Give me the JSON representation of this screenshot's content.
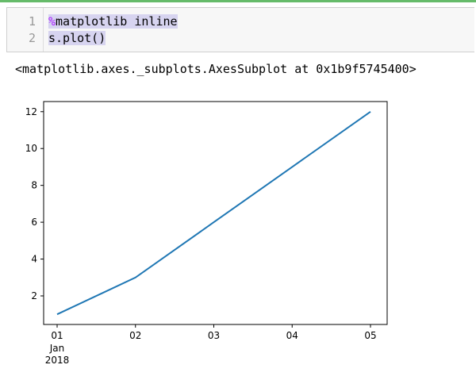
{
  "cell": {
    "line_numbers": [
      "1",
      "2"
    ],
    "line1_magic": "%",
    "line1_rest": "matplotlib inline",
    "line2": "s.plot()"
  },
  "output": {
    "repr": "<matplotlib.axes._subplots.AxesSubplot at 0x1b9f5745400>"
  },
  "chart_data": {
    "type": "line",
    "x": [
      "2018-01-01",
      "2018-01-02",
      "2018-01-03",
      "2018-01-04",
      "2018-01-05"
    ],
    "values": [
      1,
      3,
      6,
      9,
      12
    ],
    "xticks": [
      "01",
      "02",
      "03",
      "04",
      "05"
    ],
    "x_sublabel_1": "Jan",
    "x_sublabel_2": "2018",
    "yticks": [
      2,
      4,
      6,
      8,
      10,
      12
    ],
    "ylim": [
      0.45,
      12.55
    ],
    "line_color": "#1f77b4",
    "grid": false
  }
}
